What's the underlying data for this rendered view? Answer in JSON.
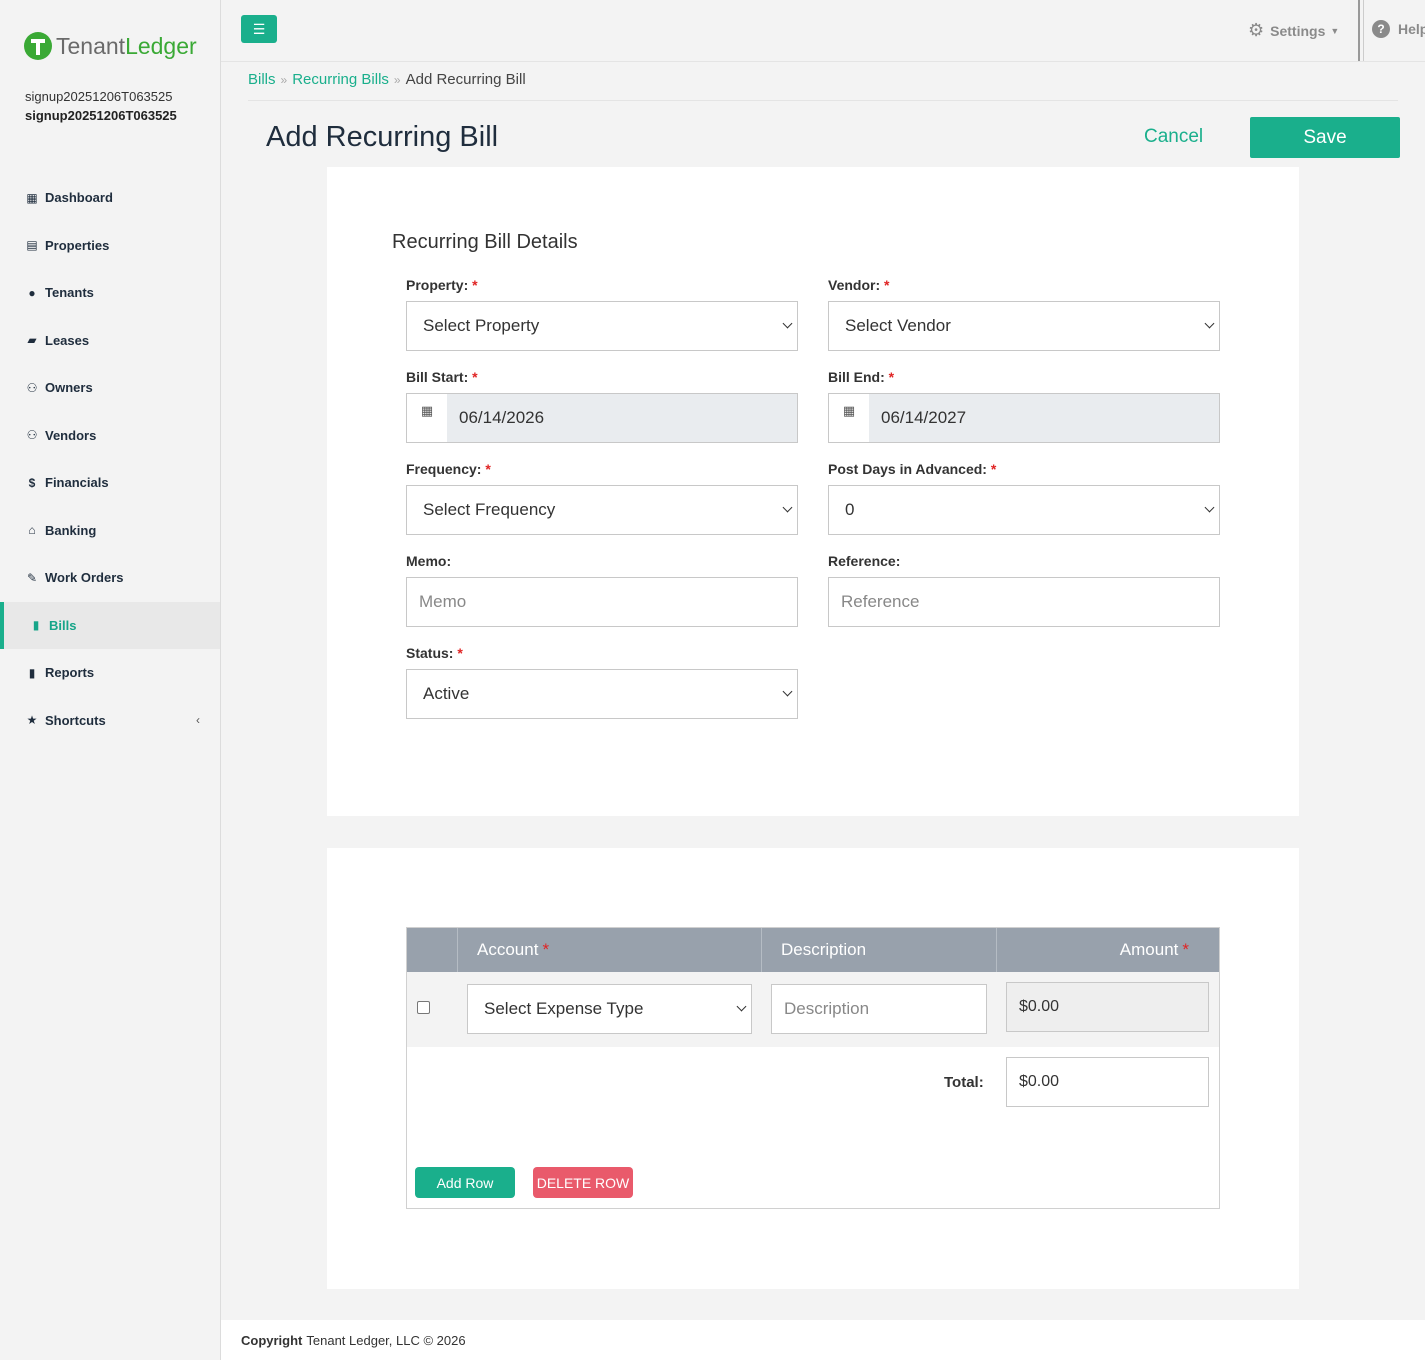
{
  "brand": {
    "name_part1": "Tenant",
    "name_part2": "Ledger",
    "accent": "#1aaf8c",
    "logo_green": "#3aa935"
  },
  "user": {
    "line1": "signup20251206T063525",
    "line2": "signup20251206T063525"
  },
  "sidebar": {
    "items": [
      {
        "label": "Dashboard",
        "icon": "dashboard-icon",
        "glyph": "▦"
      },
      {
        "label": "Properties",
        "icon": "building-icon",
        "glyph": "▤"
      },
      {
        "label": "Tenants",
        "icon": "user-icon",
        "glyph": "●"
      },
      {
        "label": "Leases",
        "icon": "folder-open-icon",
        "glyph": "▰"
      },
      {
        "label": "Owners",
        "icon": "users-icon",
        "glyph": "⚇"
      },
      {
        "label": "Vendors",
        "icon": "users-icon",
        "glyph": "⚇"
      },
      {
        "label": "Financials",
        "icon": "dollar-icon",
        "glyph": "$"
      },
      {
        "label": "Banking",
        "icon": "bank-icon",
        "glyph": "⌂"
      },
      {
        "label": "Work Orders",
        "icon": "edit-icon",
        "glyph": "✎"
      },
      {
        "label": "Bills",
        "icon": "file-icon",
        "glyph": "▮",
        "active": true
      },
      {
        "label": "Reports",
        "icon": "file-icon",
        "glyph": "▮"
      },
      {
        "label": "Shortcuts",
        "icon": "star-icon",
        "glyph": "★",
        "chevron": "‹"
      }
    ]
  },
  "topbar": {
    "settings_label": "Settings",
    "help_label": "Help"
  },
  "breadcrumb": {
    "item1": "Bills",
    "item2": "Recurring Bills",
    "current": "Add Recurring Bill",
    "separator": "»"
  },
  "page": {
    "title": "Add Recurring Bill",
    "cancel_label": "Cancel",
    "save_label": "Save"
  },
  "form": {
    "section_title": "Recurring Bill Details",
    "property": {
      "label": "Property:",
      "value": "Select Property"
    },
    "vendor": {
      "label": "Vendor:",
      "value": "Select Vendor"
    },
    "bill_start": {
      "label": "Bill Start:",
      "value": "06/14/2026"
    },
    "bill_end": {
      "label": "Bill End:",
      "value": "06/14/2027"
    },
    "frequency": {
      "label": "Frequency:",
      "value": "Select Frequency"
    },
    "post_days": {
      "label": "Post Days in Advanced:",
      "value": "0"
    },
    "memo": {
      "label": "Memo:",
      "placeholder": "Memo"
    },
    "reference": {
      "label": "Reference:",
      "placeholder": "Reference"
    },
    "status": {
      "label": "Status:",
      "value": "Active"
    },
    "required_mark": "*"
  },
  "table": {
    "headers": {
      "account": "Account",
      "description": "Description",
      "amount": "Amount"
    },
    "row": {
      "account": "Select Expense Type",
      "description_placeholder": "Description",
      "amount": "$0.00"
    },
    "total_label": "Total:",
    "total_value": "$0.00",
    "add_row_label": "Add Row",
    "delete_row_label": "DELETE ROW"
  },
  "footer": {
    "copyright_label": "Copyright",
    "text": "Tenant Ledger, LLC © 2026"
  }
}
